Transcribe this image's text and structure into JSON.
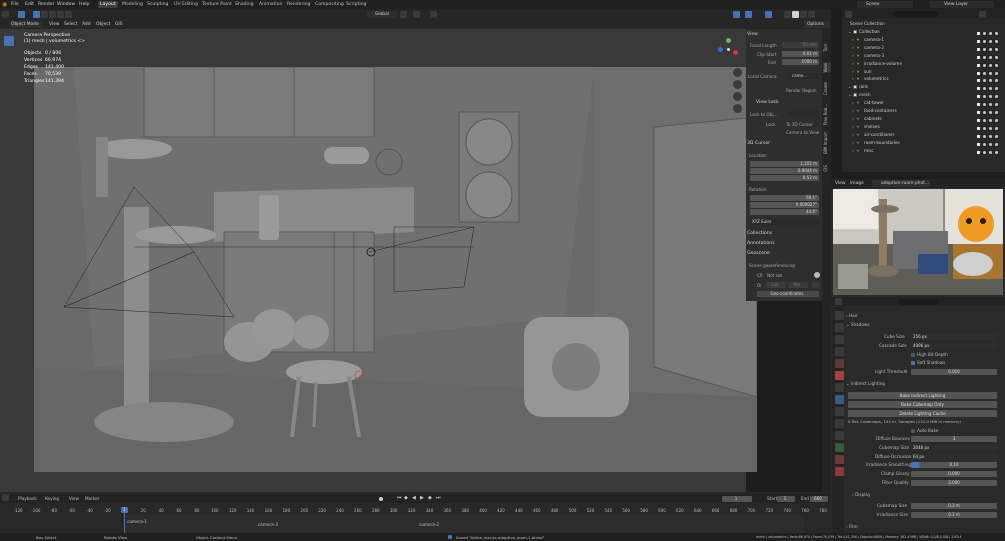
{
  "topbar": {
    "menus": [
      "File",
      "Edit",
      "Render",
      "Window",
      "Help"
    ],
    "workspaces": [
      "Layout",
      "Modeling",
      "Sculpting",
      "UV Editing",
      "Texture Paint",
      "Shading",
      "Animation",
      "Rendering",
      "Compositing",
      "Scripting"
    ],
    "scene": "Scene",
    "view_layer": "View Layer"
  },
  "viewport_header": {
    "mode": "Object Mode",
    "menus": [
      "View",
      "Select",
      "Add",
      "Object",
      "GIS"
    ],
    "transform": "Global",
    "options": "Options"
  },
  "viewport_overlay": {
    "line1": "Camera Perspective",
    "line2": "(1) mesh | volumetrics <>",
    "stats": [
      {
        "label": "Objects",
        "value": "0 / 806"
      },
      {
        "label": "Vertices",
        "value": "66,974"
      },
      {
        "label": "Edges",
        "value": "141,400"
      },
      {
        "label": "Faces",
        "value": "70,539"
      },
      {
        "label": "Triangles",
        "value": "141,394"
      }
    ]
  },
  "npanel": {
    "view_title": "View",
    "focal_length_label": "Focal Length",
    "focal_length": "50 mm",
    "clip_start_label": "Clip Start",
    "clip_start": "0.01 m",
    "end_label": "End",
    "end": "1000 m",
    "local_camera_label": "Local Camera",
    "local_camera": "came...",
    "render_region": "Render Region",
    "view_lock_title": "View Lock",
    "lock_to_object": "Lock to Obj...",
    "lock_label": "Lock",
    "to_3d_cursor": "To 3D Cursor",
    "camera_to_view": "Camera to View",
    "cursor_title": "3D Cursor",
    "location_label": "Location",
    "loc_x": "1.202 m",
    "loc_y": "0.9044 m",
    "loc_z": "0.52 m",
    "rotation_label": "Rotation",
    "rot_x": "69.1°",
    "rot_y": "0.000027°",
    "rot_z": "44.6°",
    "rot_mode": "XYZ Euler",
    "collections": "Collections",
    "annotations": "Annotations",
    "geoscene": "Geoscene",
    "scene_geo": "Scene georeferencing",
    "crs_label": "CR",
    "crs_value": "Not set",
    "or_label": "Or",
    "or_lat": "Lat",
    "or_lon": "Pro",
    "geocoord": "Geo-coordinates",
    "tabs": [
      "Tool",
      "View",
      "Create",
      "Plan Rob...",
      "BIM Import",
      "GIS"
    ]
  },
  "outliner": {
    "scene_collection": "Scene Collection",
    "items": [
      {
        "name": "Collection",
        "level": 1
      },
      {
        "name": "camera-1",
        "level": 2
      },
      {
        "name": "camera-2",
        "level": 2
      },
      {
        "name": "camera-3",
        "level": 2
      },
      {
        "name": "irradiance-volume",
        "level": 2
      },
      {
        "name": "sun",
        "level": 2
      },
      {
        "name": "volumetrics",
        "level": 2
      },
      {
        "name": "rails",
        "level": 1
      },
      {
        "name": "mesh",
        "level": 1
      },
      {
        "name": "cat-tower",
        "level": 2
      },
      {
        "name": "food-containers",
        "level": 2
      },
      {
        "name": "cabinets",
        "level": 2
      },
      {
        "name": "shelves",
        "level": 2
      },
      {
        "name": "air-conditioner",
        "level": 2
      },
      {
        "name": "room-boundaries",
        "level": 2
      },
      {
        "name": "misc",
        "level": 2
      }
    ]
  },
  "image_editor": {
    "menus": [
      "View",
      "Image"
    ],
    "image_name": "adoption-room-phot..."
  },
  "properties": {
    "hair": "Hair",
    "shadows": "Shadows",
    "cube_size_label": "Cube Size",
    "cube_size": "256 px",
    "cascade_size_label": "Cascade Size",
    "cascade_size": "4096 px",
    "high_bit_depth": "High Bit Depth",
    "soft_shadows": "Soft Shadows",
    "light_threshold_label": "Light Threshold",
    "light_threshold": "0.010",
    "indirect_lighting": "Indirect Lighting",
    "bake_indirect": "Bake Indirect Lighting",
    "bake_cubemap": "Bake Cubemap Only",
    "delete_cache": "Delete Lighting Cache",
    "cache_info": "0 Ref. Cubemaps, 144 irr. Samples (132.0 MiB in memory)",
    "auto_bake": "Auto Bake",
    "diffuse_bounces_label": "Diffuse Bounces",
    "diffuse_bounces": "3",
    "cubemap_size_label": "Cubemap Size",
    "cubemap_size": "2048 px",
    "diffuse_occlusion_label": "Diffuse Occlusion",
    "diffuse_occlusion": "64 px",
    "irradiance_smoothing_label": "Irradiance Smoothing",
    "irradiance_smoothing": "0.10",
    "clamp_glossy_label": "Clamp Glossy",
    "clamp_glossy": "0.000",
    "filter_quality_label": "Filter Quality",
    "filter_quality": "3.000",
    "display": "Display",
    "cubemap_size2_label": "Cubemap Size",
    "cubemap_size2": "0.3 m",
    "irradiance_size_label": "Irradiance Size",
    "irradiance_size": "0.1 m",
    "film": "Film"
  },
  "timeline": {
    "menus": [
      "Playback",
      "Keying",
      "View",
      "Marker"
    ],
    "current_frame": "1",
    "start_label": "Start",
    "start": "1",
    "end_label": "End",
    "end": "660",
    "ticks": [
      "-120",
      "-100",
      "-80",
      "-60",
      "-40",
      "-20",
      "0",
      "20",
      "40",
      "60",
      "80",
      "100",
      "120",
      "140",
      "160",
      "180",
      "200",
      "220",
      "240",
      "260",
      "280",
      "300",
      "320",
      "340",
      "360",
      "380",
      "400",
      "420",
      "440",
      "460",
      "480",
      "500",
      "520",
      "540",
      "560",
      "580",
      "600",
      "620",
      "640",
      "660",
      "680",
      "700",
      "720",
      "740",
      "760",
      "780"
    ],
    "frame_indicator": "1",
    "markers": [
      "camera-1",
      "camera-3",
      "camera-2"
    ]
  },
  "statusbar": {
    "left": [
      "Box Select",
      "Rotate View",
      "Object Context Menu"
    ],
    "message": "Saved \"kitten-rescue-adoption-room-1.blend\"",
    "right": "mesh | volumetrics | Verts:66,974 | Faces:70,539 | Tris:141,394 | Objects:0/806 | Memory: 382.4 MiB | VRAM: 0.0/8.0 GiB | 2.83.4"
  },
  "colors": {
    "accent": "#4772b3",
    "bg": "#1d1d1d",
    "panel": "#2a2a2a",
    "viewport": "#6b6b6b",
    "camera_orange": "#e8a33c",
    "mesh_green": "#6fb35b"
  }
}
